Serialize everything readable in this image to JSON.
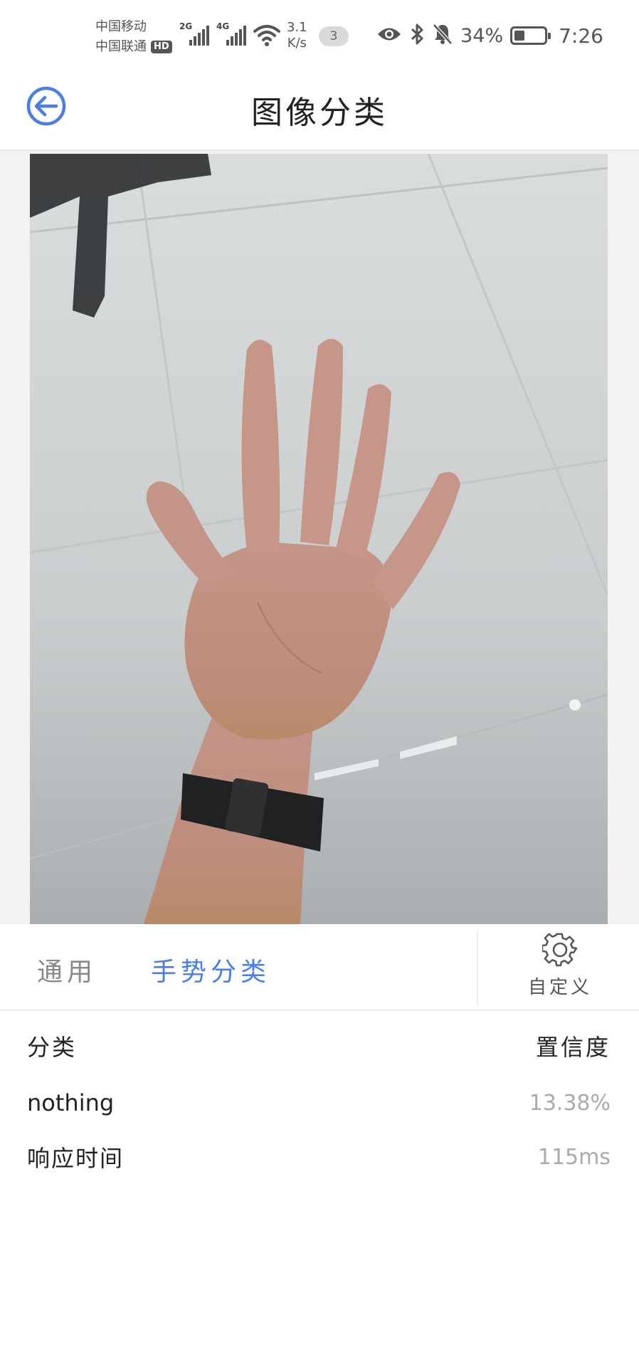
{
  "status_bar": {
    "carrier_1": "中国移动",
    "carrier_2": "中国联通",
    "hd_badge": "HD",
    "signal_1_tag": "2G",
    "signal_2_tag": "4G",
    "net_speed_value": "3.1",
    "net_speed_unit": "K/s",
    "notification_count": "3",
    "battery_percent": "34%",
    "time": "7:26"
  },
  "app_bar": {
    "title": "图像分类",
    "accent_color": "#4a7de8"
  },
  "tabs": {
    "general": "通用",
    "gesture": "手势分类",
    "custom_label": "自定义"
  },
  "results": {
    "header_class": "分类",
    "header_confidence": "置信度",
    "class_value": "nothing",
    "confidence_value": "13.38%",
    "response_label": "响应时间",
    "response_value": "115ms"
  }
}
